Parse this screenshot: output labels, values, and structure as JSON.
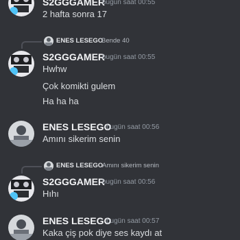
{
  "messages": [
    {
      "author": "S2GGGAMER",
      "timestamp": "bugün saat 00:55",
      "lines": [
        "2 hafta sonra 17"
      ]
    },
    {
      "reply_to": {
        "author": "ENES LESEGO",
        "text": "Bende 40"
      },
      "author": "S2GGGAMER",
      "timestamp": "bugün saat 00:55",
      "lines": [
        "Hwhw",
        "Çok komikti gulem",
        "Ha ha ha"
      ]
    },
    {
      "author": "ENES LESEGO",
      "timestamp": "bugün saat 00:56",
      "lines": [
        "Amını sikerim senin"
      ]
    },
    {
      "reply_to": {
        "author": "ENES LESEGO",
        "text": "Amını sikerim senin"
      },
      "author": "S2GGGAMER",
      "timestamp": "bugün saat 00:56",
      "lines": [
        "Hıhı"
      ]
    },
    {
      "author": "ENES LESEGO",
      "timestamp": "bugün saat 00:57",
      "lines": [
        "Kaka çiş pok diye ses kaydı at"
      ]
    }
  ],
  "colors": {
    "background": "#313338",
    "username": "#f2f3f5",
    "message_text": "#dbdee1",
    "timestamp": "#949ba4",
    "reply_line": "#4e5058"
  },
  "icons": {
    "s2g_avatar": "user-avatar-icon",
    "enes_avatar": "user-avatar-icon"
  }
}
